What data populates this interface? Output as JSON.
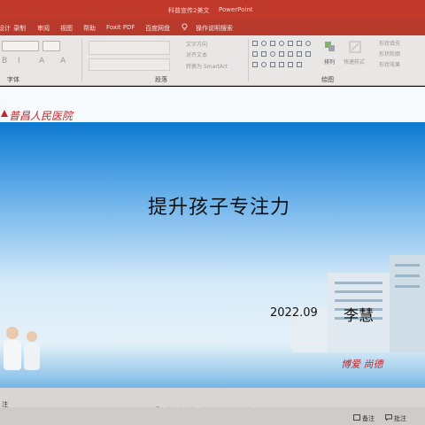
{
  "titlebar": {
    "document_title": "科普宣传2美文",
    "app_name": "PowerPoint"
  },
  "ribbon_tabs": [
    "设计",
    "录制",
    "审阅",
    "视图",
    "帮助",
    "Foxit PDF",
    "百度网盘",
    "操作说明搜索"
  ],
  "ribbon": {
    "group_font": "字体",
    "group_paragraph": "段落",
    "group_drawing": "绘图",
    "text_direction": "文字方向",
    "align_text": "对齐文本",
    "convert_smartart": "转换为 SmartArt",
    "arrange": "排列",
    "quick_styles": "快速样式",
    "shape_fill": "形状填充",
    "shape_outline": "形状轮廓",
    "shape_effects": "形状效果"
  },
  "slide": {
    "hospital_name": "普昌人民医院",
    "title": "提升孩子专注力",
    "date": "2022.09",
    "author": "李慧",
    "motto": "博爱  尚德"
  },
  "status": {
    "notes_label_left": "注",
    "notes_button": "备注",
    "comments_button": "批注",
    "slide_dots": 9,
    "active_dot": 0
  },
  "colors": {
    "accent": "#c0392b",
    "slide_blue": "#0072ce",
    "logo_red": "#c0272d"
  }
}
